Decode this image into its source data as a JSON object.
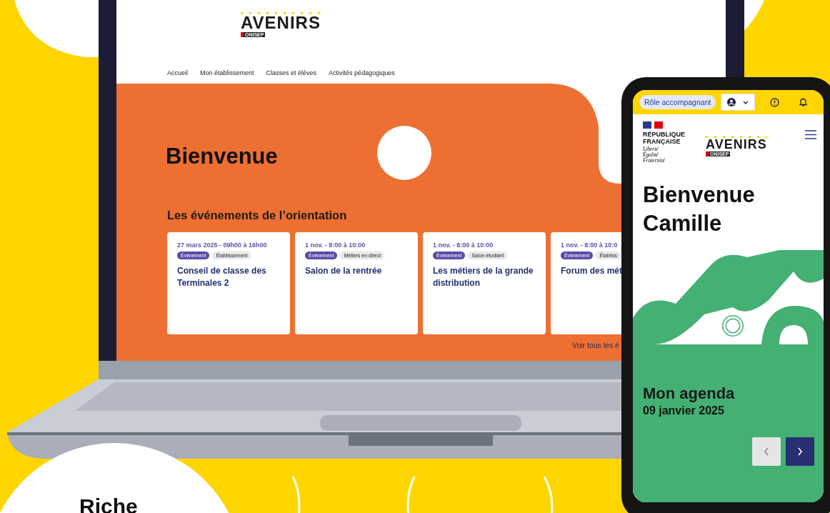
{
  "site_logo": {
    "wordmark": "AVENIRS",
    "badge": "ONISEP"
  },
  "nav": [
    {
      "label": "Accueil"
    },
    {
      "label": "Mon établissement"
    },
    {
      "label": "Classes et élèves"
    },
    {
      "label": "Activités pédagogiques"
    }
  ],
  "hero": {
    "title": "Bienvenue"
  },
  "events": {
    "heading": "Les événements de l’orientation",
    "cards": [
      {
        "date": "27 mars 2025 - 09h00 à 16h00",
        "tags": [
          {
            "label": "Évènement",
            "kind": "type"
          },
          {
            "label": "Établissement",
            "kind": "category"
          }
        ],
        "title": "Conseil de classe des Terminales 2"
      },
      {
        "date": "1 nov. - 8:00 à 10:00",
        "tags": [
          {
            "label": "Évènement",
            "kind": "type"
          },
          {
            "label": "Métiers en direct",
            "kind": "category"
          }
        ],
        "title": "Salon de la rentrée"
      },
      {
        "date": "1 nov. - 8:00 à 10:00",
        "tags": [
          {
            "label": "Évènement",
            "kind": "type"
          },
          {
            "label": "Salon étudiant",
            "kind": "category"
          }
        ],
        "title": "Les métiers de la grande distribution"
      },
      {
        "date": "1 nov. - 8:00 à 10:0",
        "tags": [
          {
            "label": "Évènement",
            "kind": "type"
          },
          {
            "label": "Établiss",
            "kind": "category"
          }
        ],
        "title": "Forum des mét"
      }
    ],
    "see_all": "Voir tous les é"
  },
  "phone": {
    "role": "Rôle accompagnant",
    "republic": "RÉPUBLIQUE FRANÇAISE",
    "motto": "Liberté Égalité Fraternité",
    "logo": {
      "wordmark": "AVENIRS",
      "badge": "ONISEP"
    },
    "welcome": "Bienvenue Camille",
    "agenda": {
      "title": "Mon agenda",
      "date": "09 janvier 2025",
      "prev": {
        "disabled": true
      },
      "next": {
        "disabled": false
      }
    }
  },
  "tagline": "Riche"
}
